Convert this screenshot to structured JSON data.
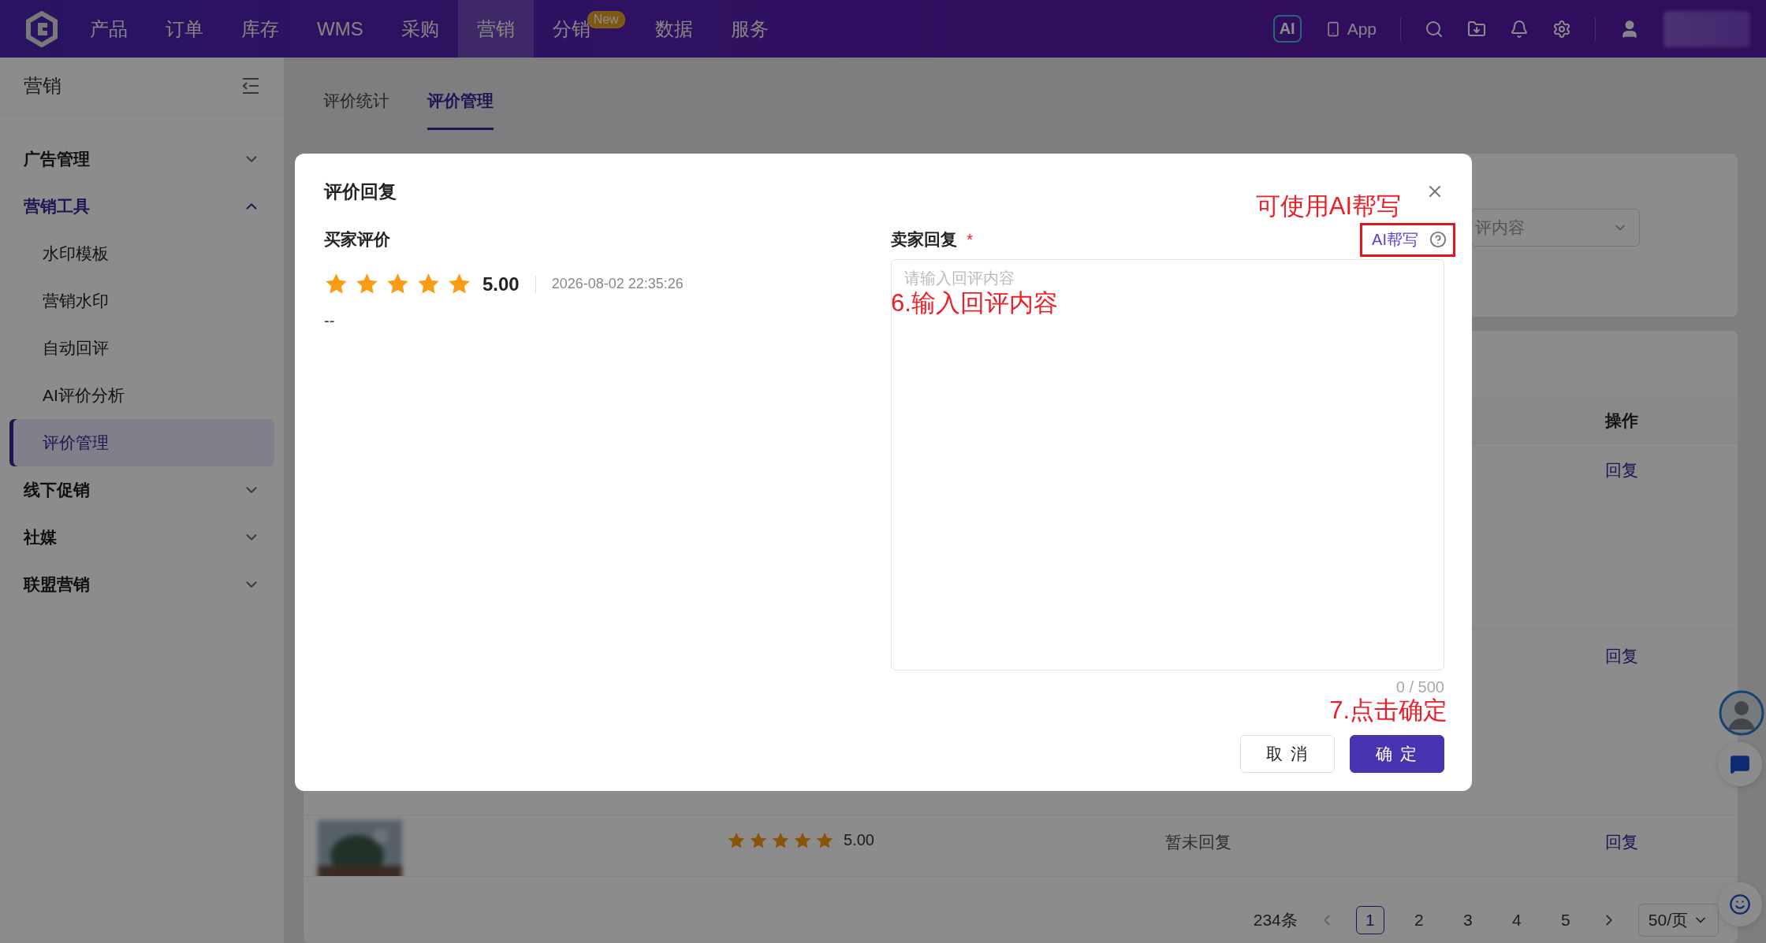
{
  "top_nav": {
    "items": [
      {
        "label": "产品",
        "selected": false
      },
      {
        "label": "订单",
        "selected": false
      },
      {
        "label": "库存",
        "selected": false
      },
      {
        "label": "WMS",
        "selected": false
      },
      {
        "label": "采购",
        "selected": false
      },
      {
        "label": "营销",
        "selected": true
      },
      {
        "label": "分销",
        "selected": false,
        "badge": "New"
      },
      {
        "label": "数据",
        "selected": false
      },
      {
        "label": "服务",
        "selected": false
      }
    ],
    "ai_badge": "AI",
    "app_label": "App"
  },
  "sidebar": {
    "title": "营销",
    "groups": [
      {
        "label": "广告管理",
        "expanded": false
      },
      {
        "label": "营销工具",
        "expanded": true,
        "children": [
          {
            "label": "水印模板",
            "selected": false
          },
          {
            "label": "营销水印",
            "selected": false
          },
          {
            "label": "自动回评",
            "selected": false
          },
          {
            "label": "AI评价分析",
            "selected": false
          },
          {
            "label": "评价管理",
            "selected": true
          }
        ]
      },
      {
        "label": "线下促销",
        "expanded": false
      },
      {
        "label": "社媒",
        "expanded": false
      },
      {
        "label": "联盟营销",
        "expanded": false
      }
    ]
  },
  "tabs": [
    {
      "label": "评价统计",
      "selected": false
    },
    {
      "label": "评价管理",
      "selected": true
    }
  ],
  "filter": {
    "select_value": "评内容"
  },
  "table": {
    "columns": [
      {
        "label": "操作"
      }
    ],
    "rows": [
      {
        "kind": "covered",
        "action": "回复"
      },
      {
        "kind": "covered",
        "action": "回复"
      },
      {
        "kind": "full",
        "stars": 5,
        "rating": "5.00",
        "status": "暂未回复",
        "action": "回复"
      }
    ]
  },
  "pagination": {
    "total": "234条",
    "pages": [
      {
        "label": "1",
        "selected": true
      },
      {
        "label": "2",
        "selected": false
      },
      {
        "label": "3",
        "selected": false
      },
      {
        "label": "4",
        "selected": false
      },
      {
        "label": "5",
        "selected": false
      }
    ],
    "page_size": "50/页"
  },
  "modal": {
    "title": "评价回复",
    "buyer": {
      "label": "买家评价",
      "stars": 5,
      "rating": "5.00",
      "date": "2026-08-02 22:35:26",
      "comment": "--"
    },
    "seller": {
      "label": "卖家回复",
      "required_mark": "*",
      "ai_link": "AI帮写",
      "placeholder": "请输入回评内容",
      "counter": "0 / 500"
    },
    "buttons": [
      {
        "label": "取 消",
        "kind": "default"
      },
      {
        "label": "确 定",
        "kind": "primary"
      }
    ]
  },
  "annotations": [
    {
      "text": "可使用AI帮写"
    },
    {
      "text": "6.输入回评内容"
    },
    {
      "text": "7.点击确定"
    }
  ]
}
